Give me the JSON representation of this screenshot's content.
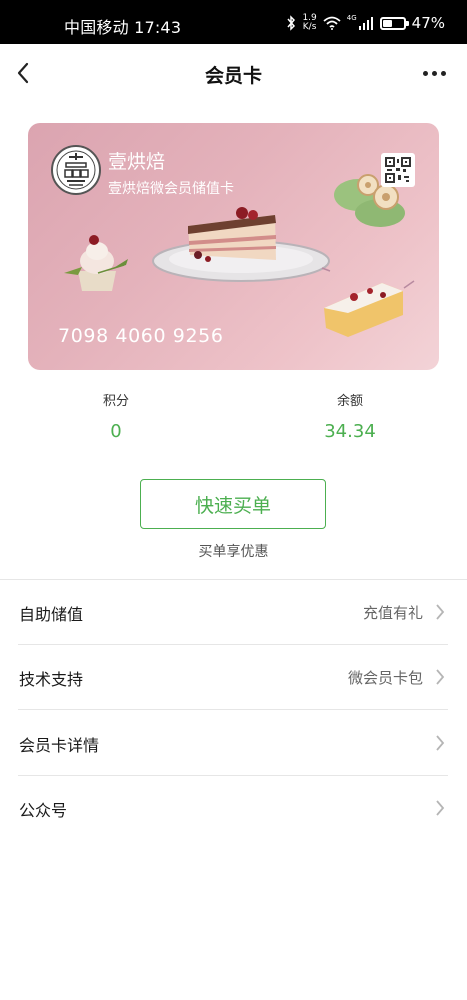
{
  "status_bar": {
    "carrier_time": "中国移动 17:43",
    "speed_value": "1.9",
    "speed_unit": "K/s",
    "network": "4G",
    "battery_percent": "47%",
    "battery_level": 0.47,
    "icons": [
      "bluetooth-icon",
      "wifi-icon",
      "signal-icon",
      "battery-icon"
    ]
  },
  "nav": {
    "title": "会员卡",
    "icons": [
      "back-arrow-icon",
      "more-icon"
    ]
  },
  "card": {
    "brand_name": "壹烘焙",
    "subtitle": "壹烘焙微会员储值卡",
    "number": "7098 4060 9256",
    "colors": {
      "background_start": "#dba4b0",
      "background_end": "#f3d3d7"
    },
    "icons": [
      "shop-logo-icon",
      "qr-code-icon"
    ]
  },
  "stats": {
    "points_label": "积分",
    "points_value": "0",
    "balance_label": "余额",
    "balance_value": "34.34"
  },
  "buy": {
    "button_label": "快速买单",
    "hint": "买单享优惠"
  },
  "menu": [
    {
      "label": "自助储值",
      "value": "充值有礼"
    },
    {
      "label": "技术支持",
      "value": "微会员卡包"
    },
    {
      "label": "会员卡详情",
      "value": ""
    },
    {
      "label": "公众号",
      "value": ""
    }
  ],
  "colors": {
    "accent": "#4caf50",
    "status_bar": "#000000",
    "divider": "#e6e6e6"
  }
}
